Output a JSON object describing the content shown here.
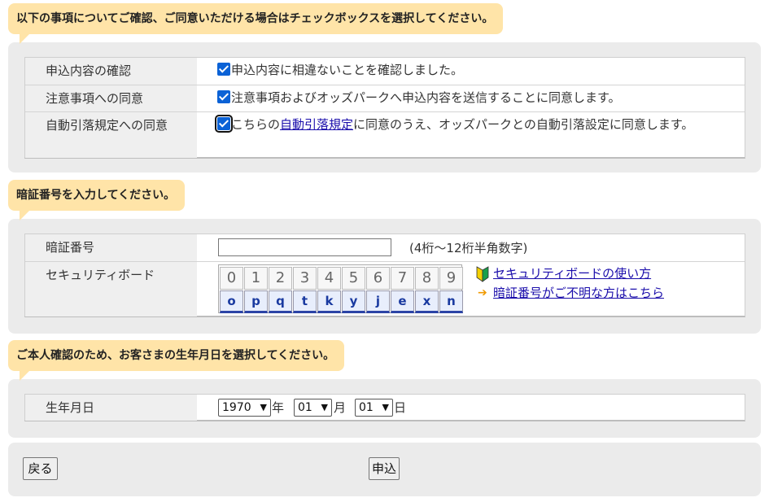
{
  "section1": {
    "heading": "以下の事項についてご確認、ご同意いただける場合はチェックボックスを選択してください。",
    "rows": [
      {
        "label": "申込内容の確認",
        "text": "申込内容に相違ないことを確認しました。"
      },
      {
        "label": "注意事項への同意",
        "text": "注意事項およびオッズパークへ申込内容を送信することに同意します。"
      },
      {
        "label": "自動引落規定への同意",
        "pre": "こちらの",
        "link": "自動引落規定",
        "post": "に同意のうえ、オッズパークとの自動引落設定に同意します。"
      }
    ]
  },
  "section2": {
    "heading": "暗証番号を入力してください。",
    "pin_label": "暗証番号",
    "pin_value": "",
    "pin_hint": "(4桁～12桁半角数字)",
    "board_label": "セキュリティボード",
    "digits": [
      "0",
      "1",
      "2",
      "3",
      "4",
      "5",
      "6",
      "7",
      "8",
      "9"
    ],
    "letters": [
      "o",
      "p",
      "q",
      "t",
      "k",
      "y",
      "j",
      "e",
      "x",
      "n"
    ],
    "help_link": "セキュリティボードの使い方",
    "forgot_link": "暗証番号がご不明な方はこちら"
  },
  "section3": {
    "heading": "ご本人確認のため、お客さまの生年月日を選択してください。",
    "label": "生年月日",
    "year": "1970",
    "year_unit": "年",
    "month": "01",
    "month_unit": "月",
    "day": "01",
    "day_unit": "日"
  },
  "actions": {
    "back": "戻る",
    "submit": "申込"
  }
}
